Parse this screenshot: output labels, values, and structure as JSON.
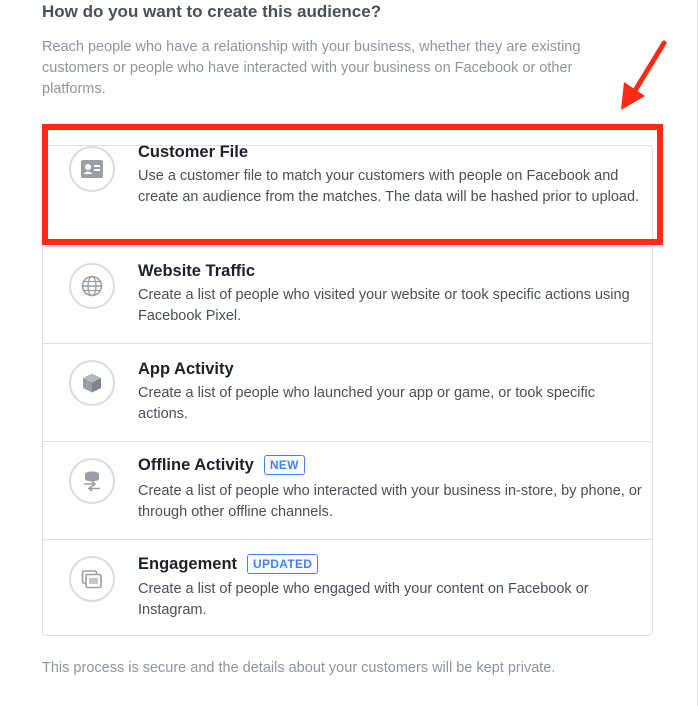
{
  "title": "How do you want to create this audience?",
  "intro": "Reach people who have a relationship with your business, whether they are existing customers or people who have interacted with your business on Facebook or other platforms.",
  "options": [
    {
      "title": "Customer File",
      "description": "Use a customer file to match your customers with people on Facebook and create an audience from the matches. The data will be hashed prior to upload.",
      "icon": "contact-card-icon",
      "badge": ""
    },
    {
      "title": "Website Traffic",
      "description": "Create a list of people who visited your website or took specific actions using Facebook Pixel.",
      "icon": "globe-icon",
      "badge": ""
    },
    {
      "title": "App Activity",
      "description": "Create a list of people who launched your app or game, or took specific actions.",
      "icon": "cube-icon",
      "badge": ""
    },
    {
      "title": "Offline Activity",
      "description": "Create a list of people who interacted with your business in-store, by phone, or through other offline channels.",
      "icon": "database-sync-icon",
      "badge": "NEW"
    },
    {
      "title": "Engagement",
      "description": "Create a list of people who engaged with your content on Facebook or Instagram.",
      "icon": "stacked-posts-icon",
      "badge": "UPDATED"
    }
  ],
  "footer": "This process is secure and the details about your customers will be kept private.",
  "colors": {
    "highlight": "#ff2a16",
    "badge": "#4080ff",
    "title_text": "#1d2129",
    "muted_text": "#90949c",
    "border": "#dddfe2"
  }
}
